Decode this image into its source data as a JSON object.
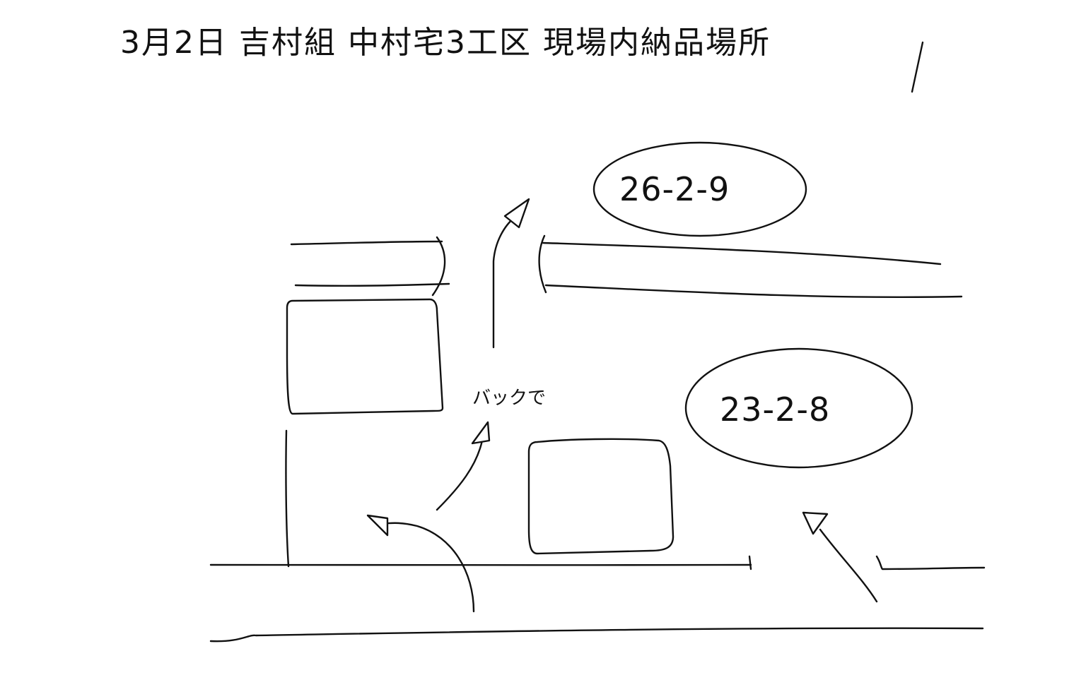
{
  "title": "3月2日 吉村組 中村宅3工区 現場内納品場所",
  "lots": {
    "upper": "26-2-9",
    "lower": "23-2-8"
  },
  "note": "バックで",
  "colors": {
    "ink": "#111111",
    "paper": "#ffffff"
  }
}
